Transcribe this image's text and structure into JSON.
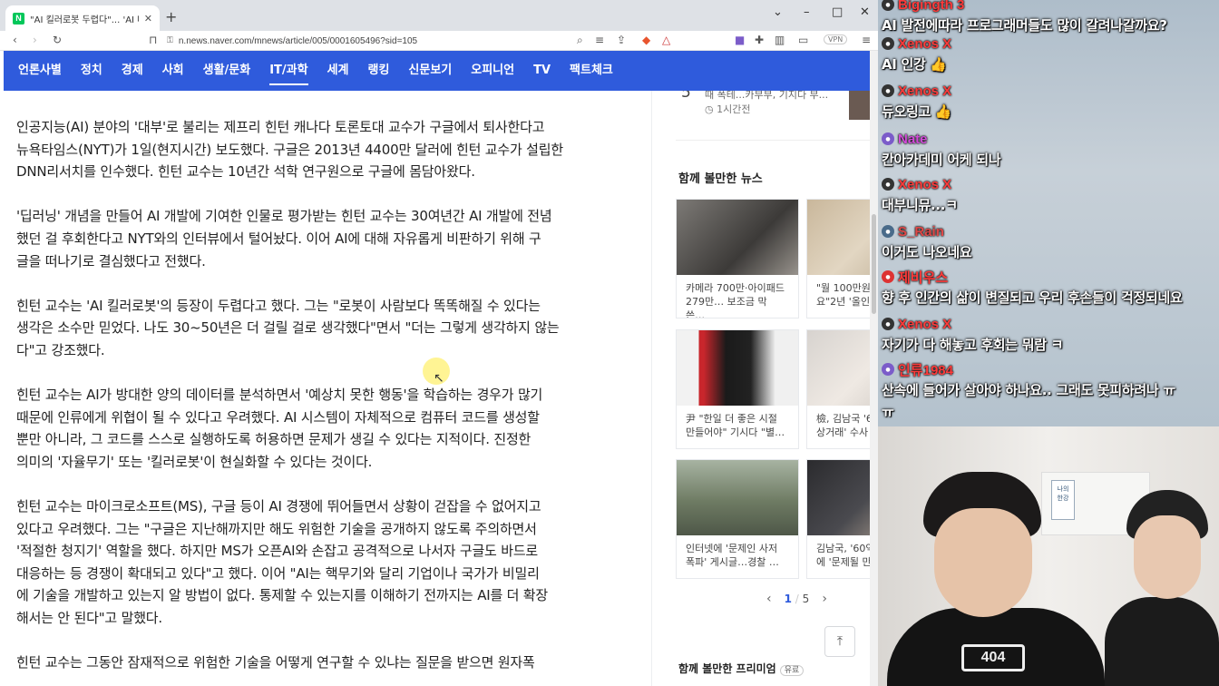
{
  "browser": {
    "tab_title": "\"AI 킬러로봇 두렵다\"... 'AI 대부'",
    "tab_close": "✕",
    "new_tab": "+",
    "url": "n.news.naver.com/mnews/article/005/0001605496?sid=105",
    "vpn": "VPN"
  },
  "nav": {
    "items": [
      "언론사별",
      "정치",
      "경제",
      "사회",
      "생활/문화",
      "IT/과학",
      "세계",
      "랭킹",
      "신문보기",
      "오피니언",
      "TV",
      "팩트체크"
    ],
    "active": "IT/과학"
  },
  "article": {
    "paragraphs": [
      "인공지능(AI) 분야의 '대부'로 불리는 제프리 힌턴 캐나다 토론토대 교수가 구글에서 퇴사한다고\n뉴욕타임스(NYT)가 1일(현지시간) 보도했다. 구글은 2013년 4400만 달러에 힌턴 교수가 설립한\nDNN리서치를 인수했다. 힌턴 교수는 10년간 석학 연구원으로 구글에 몸담아왔다.",
      "'딥러닝' 개념을 만들어 AI 개발에 기여한 인물로 평가받는 힌턴 교수는 30여년간 AI 개발에 전념\n했던 걸 후회한다고 NYT와의 인터뷰에서 털어놨다. 이어 AI에 대해 자유롭게 비판하기 위해 구\n글을 떠나기로 결심했다고 전했다.",
      "힌턴 교수는 'AI 킬러로봇'의 등장이 두렵다고 했다. 그는 \"로봇이 사람보다 똑똑해질 수 있다는\n생각은 소수만 믿었다. 나도 30~50년은 더 걸릴 걸로 생각했다\"면서 \"더는 그렇게 생각하지 않는\n다\"고 강조했다.",
      "힌턴 교수는 AI가 방대한 양의 데이터를 분석하면서 '예상치 못한 행동'을 학습하는 경우가 많기\n때문에 인류에게 위협이 될 수 있다고 우려했다. AI 시스템이 자체적으로 컴퓨터 코드를 생성할\n뿐만 아니라, 그 코드를 스스로 실행하도록 허용하면 문제가 생길 수 있다는 지적이다. 진정한\n의미의 '자율무기' 또는 '킬러로봇'이 현실화할 수 있다는 것이다.",
      "힌턴 교수는 마이크로소프트(MS), 구글 등이 AI 경쟁에 뛰어들면서 상황이 걷잡을 수 없어지고\n있다고 우려했다. 그는 \"구글은 지난해까지만 해도 위험한 기술을 공개하지 않도록 주의하면서\n'적절한 청지기' 역할을 했다. 하지만 MS가 오픈AI와 손잡고 공격적으로 나서자 구글도 바드로\n대응하는 등 경쟁이 확대되고 있다\"고 했다. 이어 \"AI는 핵무기와 달리 기업이나 국가가 비밀리\n에 기술을 개발하고 있는지 알 방법이 없다. 통제할 수 있는지를 이해하기 전까지는 AI를 더 확장\n해서는 안 된다\"고 말했다.",
      "힌턴 교수는 그동안 잠재적으로 위험한 기술을 어떻게 연구할 수 있냐는 질문을 받으면 원자폭"
    ]
  },
  "sidebar": {
    "rank_number": "5",
    "rank_title": "때 폭테...카부부, 기지다 부...",
    "rank_time": "1시간전",
    "together_title": "함께 볼만한 뉴스",
    "cards": [
      {
        "caption": "카메라 700만·아이패드\n279만… 보조금 막 쓴…"
      },
      {
        "caption": "\"월 100만원…\n요\"2년 '올인"
      },
      {
        "caption": "尹 \"한일 더 좋은 시절\n만들어야\" 기시다 \"별…"
      },
      {
        "caption": "檢, 김남국 '6\n상거래' 수사"
      },
      {
        "caption": "인터넷에 '문제인 사저\n폭파' 게시글…경찰 …"
      },
      {
        "caption": "김남국, '60억\n에 '문제될 만"
      }
    ],
    "pager": {
      "current": "1",
      "sep": "/",
      "total": "5",
      "prev": "‹",
      "next": "›"
    },
    "premium_title": "함께 볼만한 프리미엄",
    "premium_badge": "유료"
  },
  "chat": {
    "messages": [
      {
        "user": "Bigingth 3",
        "text": "AI 발전에따라 프로그래머들도 많이 갈려나갈까요?",
        "color": "#ff3b3b"
      },
      {
        "user": "Xenos X",
        "text": "AI 인강 👍",
        "color": "#ff3b3b"
      },
      {
        "user": "Xenos X",
        "text": "듀오링고 👍",
        "color": "#ff3b3b"
      },
      {
        "user": "Nate",
        "text": "칸아카데미 어케 되나",
        "color": "#d14bd8"
      },
      {
        "user": "Xenos X",
        "text": "대부니뮤...ㅋ",
        "color": "#ff3b3b"
      },
      {
        "user": "S_Rain",
        "text": "이거도 나오네요",
        "color": "#e04848"
      },
      {
        "user": "제비우스",
        "text": "향 후 인간의 삶이 변질되고 우리 후손들이 걱정되네요",
        "color": "#ff3b3b"
      },
      {
        "user": "Xenos X",
        "text": "자기가 다 해놓고 후회는 뭐람 ㅋ",
        "color": "#ff3b3b"
      },
      {
        "user": "인류1984",
        "text": "산속에 들어가 살아야 하나요.. 그래도 못피하려나 ㅠ\nㅠ",
        "color": "#ff3b3b"
      }
    ]
  },
  "webcam": {
    "shirt_logo": "404",
    "sign_text": "나의\n한강"
  },
  "colors": {
    "nav_bg": "#2f5bdc",
    "accent": "#2f5bdc"
  }
}
